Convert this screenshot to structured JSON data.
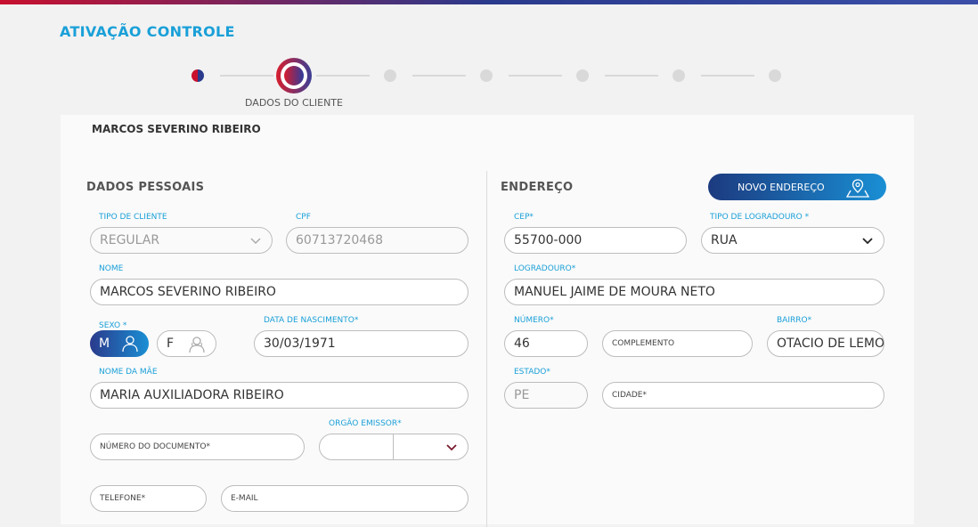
{
  "page": {
    "title": "ATIVAÇÃO CONTROLE"
  },
  "stepper": {
    "active_label": "DADOS DO CLIENTE"
  },
  "client": {
    "name": "MARCOS SEVERINO RIBEIRO"
  },
  "personal": {
    "section_title": "DADOS PESSOAIS",
    "tipo_cliente": {
      "label": "TIPO DE CLIENTE",
      "value": "REGULAR"
    },
    "cpf": {
      "label": "CPF",
      "value": "60713720468"
    },
    "nome": {
      "label": "NOME",
      "value": "MARCOS SEVERINO RIBEIRO"
    },
    "sexo": {
      "label": "SEXO *",
      "male": "M",
      "female": "F",
      "selected": "M"
    },
    "nascimento": {
      "label": "DATA DE NASCIMENTO*",
      "value": "30/03/1971"
    },
    "nome_mae": {
      "label": "NOME DA MÃE",
      "value": "MARIA AUXILIADORA RIBEIRO"
    },
    "documento": {
      "placeholder": "NÚMERO DO DOCUMENTO*"
    },
    "orgao_emissor": {
      "label": "ORGÃO EMISSOR*"
    },
    "telefone": {
      "placeholder": "TELEFONE*"
    },
    "email": {
      "placeholder": "E-MAIL"
    }
  },
  "address": {
    "section_title": "ENDEREÇO",
    "novo_button": "NOVO ENDEREÇO",
    "cep": {
      "label": "CEP*",
      "value": "55700-000"
    },
    "tipo_logradouro": {
      "label": "TIPO DE LOGRADOURO *",
      "value": "RUA"
    },
    "logradouro": {
      "label": "LOGRADOURO*",
      "value": "MANUEL JAIME DE MOURA NETO"
    },
    "numero": {
      "label": "NÚMERO*",
      "value": "46"
    },
    "complemento": {
      "placeholder": "COMPLEMENTO"
    },
    "bairro": {
      "label": "BAIRRO*",
      "value": "OTACIO DE LEMOS"
    },
    "estado": {
      "label": "ESTADO*",
      "value": "PE"
    },
    "cidade": {
      "placeholder": "CIDADE*"
    }
  },
  "colors": {
    "accent": "#1aa0d8",
    "brand_red": "#c8102e",
    "brand_blue": "#2a3a8c"
  }
}
